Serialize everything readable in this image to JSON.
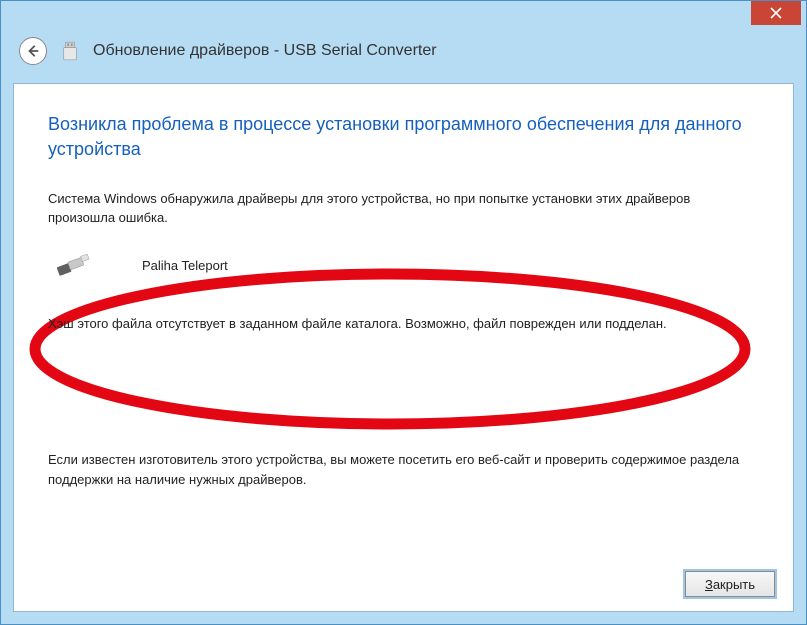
{
  "header": {
    "title": "Обновление драйверов - USB Serial Converter"
  },
  "content": {
    "heading": "Возникла проблема в процессе установки программного обеспечения для данного устройства",
    "description": "Система Windows обнаружила драйверы для этого устройства, но при попытке установки этих драйверов произошла ошибка.",
    "device_name": "Paliha Teleport",
    "error_message": "Хэш этого файла отсутствует в заданном файле каталога. Возможно, файл поврежден или подделан.",
    "hint": "Если известен изготовитель этого устройства, вы можете посетить его веб-сайт и проверить содержимое раздела поддержки на наличие нужных драйверов."
  },
  "footer": {
    "close_label": "Закрыть"
  }
}
